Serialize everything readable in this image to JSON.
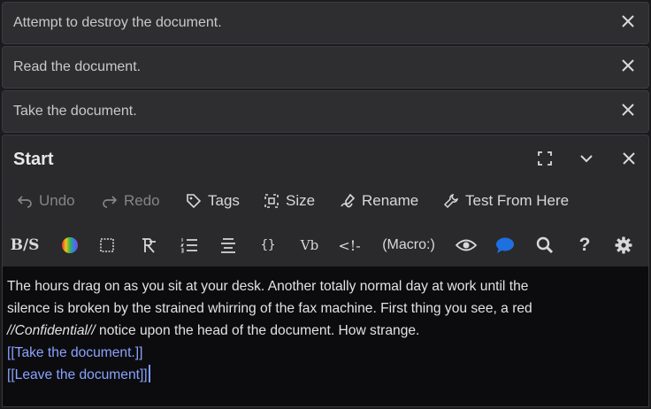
{
  "stacked_passages": [
    {
      "title": "Attempt to destroy the document."
    },
    {
      "title": "Read the document."
    },
    {
      "title": "Take the document."
    }
  ],
  "dialog": {
    "title": "Start"
  },
  "toolbar": {
    "undo": "Undo",
    "redo": "Redo",
    "tags": "Tags",
    "size": "Size",
    "rename": "Rename",
    "test_from_here": "Test From Here"
  },
  "format_toolbar": {
    "bold_strike": "B/S",
    "macro": "(Macro:)",
    "verbatim": "Vb",
    "collapse": "{}",
    "help": "?",
    "comment": "<!-",
    "icons": [
      "bold-strike-icon",
      "color-icon",
      "border-icon",
      "align-icon",
      "list-icon",
      "center-icon",
      "collapse-icon",
      "verbatim-icon",
      "comment-icon",
      "macro-icon",
      "eye-icon",
      "chat-icon",
      "search-icon",
      "help-icon",
      "gear-icon"
    ]
  },
  "editor": {
    "line1": "The hours drag on as you sit at your desk. Another totally normal day at work until the",
    "line2": "silence is broken by the strained whirring of the fax machine. First thing you see, a red",
    "line3_italic": "//Confidential//",
    "line3_rest": " notice upon the head of the document. How strange.",
    "line4": "[[Take the document.]]",
    "line5": "[[Leave the document]]"
  },
  "colors": {
    "background": "#1b1b1e",
    "editor_bg": "#0c0c0e",
    "link": "#8aa3ff",
    "accent_blue": "#1e6fe0"
  }
}
